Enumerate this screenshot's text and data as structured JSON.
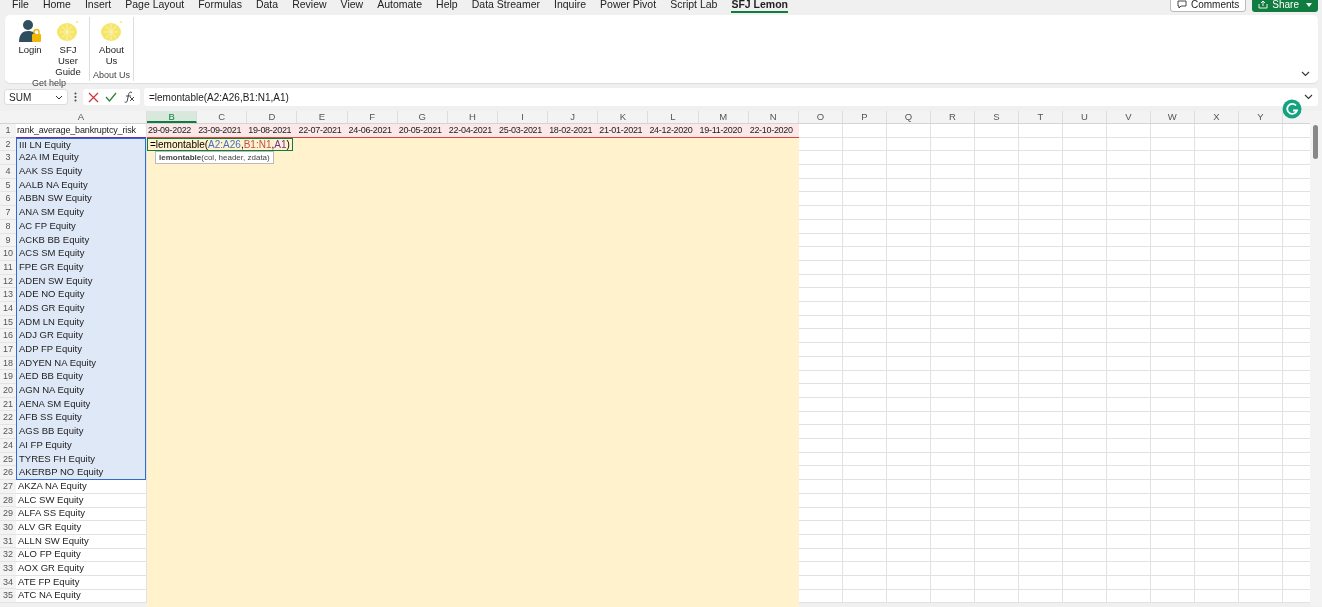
{
  "menu_tabs": [
    {
      "label": "File",
      "selected": false
    },
    {
      "label": "Home",
      "selected": false
    },
    {
      "label": "Insert",
      "selected": false
    },
    {
      "label": "Page Layout",
      "selected": false
    },
    {
      "label": "Formulas",
      "selected": false
    },
    {
      "label": "Data",
      "selected": false
    },
    {
      "label": "Review",
      "selected": false
    },
    {
      "label": "View",
      "selected": false
    },
    {
      "label": "Automate",
      "selected": false
    },
    {
      "label": "Help",
      "selected": false
    },
    {
      "label": "Data Streamer",
      "selected": false
    },
    {
      "label": "Inquire",
      "selected": false
    },
    {
      "label": "Power Pivot",
      "selected": false
    },
    {
      "label": "Script Lab",
      "selected": false
    },
    {
      "label": "SFJ Lemon",
      "selected": true
    }
  ],
  "header_buttons": [
    {
      "label": "Comments",
      "kind": "comments"
    },
    {
      "label": "Share",
      "kind": "share"
    }
  ],
  "ribbon_groups": [
    {
      "label": "Get help",
      "buttons": [
        {
          "label": "Login",
          "kind": "user"
        },
        {
          "label": "SFJ User Guide",
          "kind": "lemon"
        }
      ]
    },
    {
      "label": "About Us",
      "buttons": [
        {
          "label": "About Us",
          "kind": "lemon"
        }
      ]
    }
  ],
  "name_box": "SUM",
  "formula": "=lemontable(A2:A26,B1:N1,A1)",
  "columns": [
    {
      "label": "A",
      "selected": false
    },
    {
      "label": "B",
      "selected": true
    },
    {
      "label": "C",
      "selected": false
    },
    {
      "label": "D",
      "selected": false
    },
    {
      "label": "E",
      "selected": false
    },
    {
      "label": "F",
      "selected": false
    },
    {
      "label": "G",
      "selected": false
    },
    {
      "label": "H",
      "selected": false
    },
    {
      "label": "I",
      "selected": false
    },
    {
      "label": "J",
      "selected": false
    },
    {
      "label": "K",
      "selected": false
    },
    {
      "label": "L",
      "selected": false
    },
    {
      "label": "M",
      "selected": false
    },
    {
      "label": "N",
      "selected": false
    },
    {
      "label": "O",
      "selected": false
    },
    {
      "label": "P",
      "selected": false
    },
    {
      "label": "Q",
      "selected": false
    },
    {
      "label": "R",
      "selected": false
    },
    {
      "label": "S",
      "selected": false
    },
    {
      "label": "T",
      "selected": false
    },
    {
      "label": "U",
      "selected": false
    },
    {
      "label": "V",
      "selected": false
    },
    {
      "label": "W",
      "selected": false
    },
    {
      "label": "X",
      "selected": false
    },
    {
      "label": "Y",
      "selected": false
    }
  ],
  "rows": [
    {
      "number": "1",
      "selected": false,
      "cells": [
        "rank_average_bankruptcy_risk",
        "29-09-2022",
        "23-09-2021",
        "19-08-2021",
        "22-07-2021",
        "24-06-2021",
        "20-05-2021",
        "22-04-2021",
        "25-03-2021",
        "18-02-2021",
        "21-01-2021",
        "24-12-2020",
        "19-11-2020",
        "22-10-2020"
      ]
    },
    {
      "number": "2",
      "selected": true,
      "cells": [
        "III LN Equity"
      ]
    },
    {
      "number": "3",
      "selected": true,
      "cells": [
        "A2A IM Equity"
      ]
    },
    {
      "number": "4",
      "selected": true,
      "cells": [
        "AAK SS Equity"
      ]
    },
    {
      "number": "5",
      "selected": true,
      "cells": [
        "AALB NA Equity"
      ]
    },
    {
      "number": "6",
      "selected": true,
      "cells": [
        "ABBN SW Equity"
      ]
    },
    {
      "number": "7",
      "selected": true,
      "cells": [
        "ANA SM Equity"
      ]
    },
    {
      "number": "8",
      "selected": true,
      "cells": [
        "AC FP Equity"
      ]
    },
    {
      "number": "9",
      "selected": true,
      "cells": [
        "ACKB BB Equity"
      ]
    },
    {
      "number": "10",
      "selected": true,
      "cells": [
        "ACS SM Equity"
      ]
    },
    {
      "number": "11",
      "selected": true,
      "cells": [
        "FPE GR Equity"
      ]
    },
    {
      "number": "12",
      "selected": true,
      "cells": [
        "ADEN SW Equity"
      ]
    },
    {
      "number": "13",
      "selected": true,
      "cells": [
        "ADE NO Equity"
      ]
    },
    {
      "number": "14",
      "selected": true,
      "cells": [
        "ADS GR Equity"
      ]
    },
    {
      "number": "15",
      "selected": true,
      "cells": [
        "ADM LN Equity"
      ]
    },
    {
      "number": "16",
      "selected": true,
      "cells": [
        "ADJ GR Equity"
      ]
    },
    {
      "number": "17",
      "selected": true,
      "cells": [
        "ADP FP Equity"
      ]
    },
    {
      "number": "18",
      "selected": true,
      "cells": [
        "ADYEN NA Equity"
      ]
    },
    {
      "number": "19",
      "selected": true,
      "cells": [
        "AED BB Equity"
      ]
    },
    {
      "number": "20",
      "selected": true,
      "cells": [
        "AGN NA Equity"
      ]
    },
    {
      "number": "21",
      "selected": true,
      "cells": [
        "AENA SM Equity"
      ]
    },
    {
      "number": "22",
      "selected": true,
      "cells": [
        "AFB SS Equity"
      ]
    },
    {
      "number": "23",
      "selected": true,
      "cells": [
        "AGS BB Equity"
      ]
    },
    {
      "number": "24",
      "selected": true,
      "cells": [
        "AI FP Equity"
      ]
    },
    {
      "number": "25",
      "selected": true,
      "cells": [
        "TYRES FH Equity"
      ]
    },
    {
      "number": "26",
      "selected": true,
      "cells": [
        "AKERBP NO Equity"
      ]
    },
    {
      "number": "27",
      "selected": false,
      "cells": [
        "AKZA NA Equity"
      ]
    },
    {
      "number": "28",
      "selected": false,
      "cells": [
        "ALC SW Equity"
      ]
    },
    {
      "number": "29",
      "selected": false,
      "cells": [
        "ALFA SS Equity"
      ]
    },
    {
      "number": "30",
      "selected": false,
      "cells": [
        "ALV GR Equity"
      ]
    },
    {
      "number": "31",
      "selected": false,
      "cells": [
        "ALLN SW Equity"
      ]
    },
    {
      "number": "32",
      "selected": false,
      "cells": [
        "ALO FP Equity"
      ]
    },
    {
      "number": "33",
      "selected": false,
      "cells": [
        "AOX GR Equity"
      ]
    },
    {
      "number": "34",
      "selected": false,
      "cells": [
        "ATE FP Equity"
      ]
    },
    {
      "number": "35",
      "selected": false,
      "cells": [
        "ATC NA Equity"
      ]
    }
  ],
  "edit_cell": {
    "segments": [
      {
        "text": "=lemontable(",
        "kind": "plain"
      },
      {
        "text": "A2:A26",
        "kind": "reference",
        "color": "#4472c4"
      },
      {
        "text": ",",
        "kind": "plain"
      },
      {
        "text": "B1:N1",
        "kind": "reference",
        "color": "#c0504d"
      },
      {
        "text": ",",
        "kind": "plain"
      },
      {
        "text": "A1",
        "kind": "reference",
        "color": "#7030a0"
      },
      {
        "text": ")",
        "kind": "plain"
      }
    ],
    "hint": "**lemontable**(col, header, zdata)"
  }
}
